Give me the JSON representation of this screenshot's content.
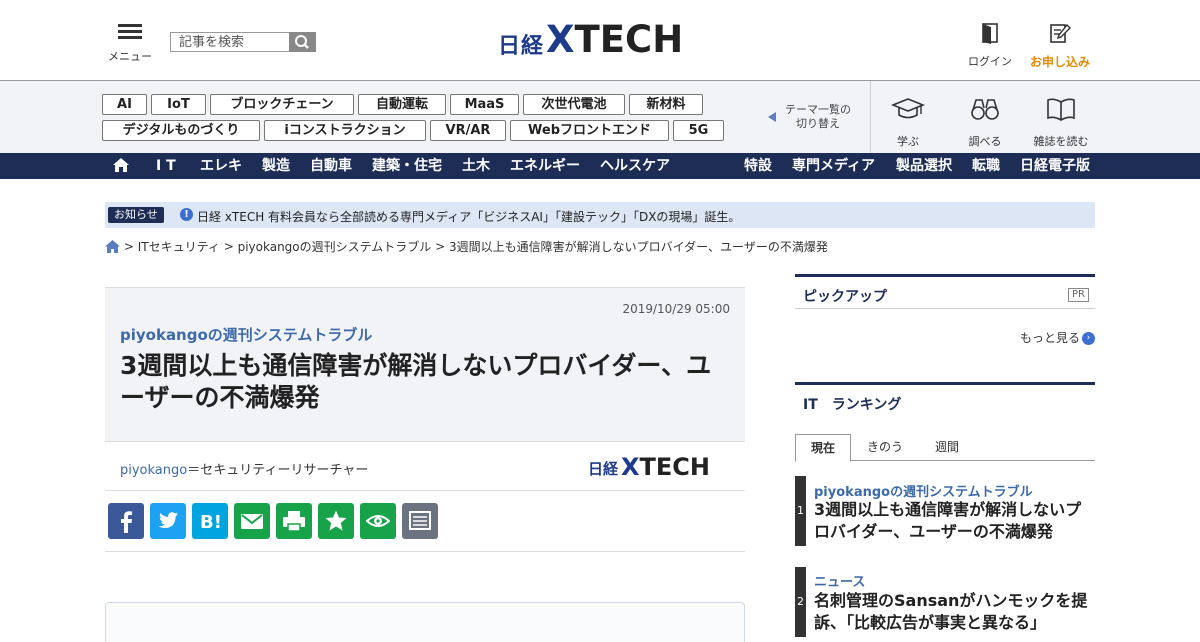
{
  "header": {
    "menu_label": "メニュー",
    "search_placeholder": "記事を検索",
    "logo_nikkei": "日経",
    "logo_x": "X",
    "logo_tech": "TECH",
    "login_label": "ログイン",
    "apply_label": "お申し込み",
    "accent_color": "#e38a00",
    "brand_color": "#1d2d56"
  },
  "themes": {
    "tags": [
      "AI",
      "IoT",
      "ブロックチェーン",
      "自動運転",
      "MaaS",
      "次世代電池",
      "新材料",
      "デジタルものづくり",
      "iコンストラクション",
      "VR/AR",
      "Webフロントエンド",
      "5G"
    ],
    "switch_label_1": "テーマ一覧の",
    "switch_label_2": "切り替え",
    "quick_actions": [
      "学ぶ",
      "調べる",
      "雑誌を読む"
    ]
  },
  "nav": {
    "left": [
      "I T",
      "エレキ",
      "製造",
      "自動車",
      "建築・住宅",
      "土木",
      "エネルギー",
      "ヘルスケア"
    ],
    "right": [
      "特設",
      "専門メディア",
      "製品選択",
      "転職",
      "日経電子版"
    ]
  },
  "notice": {
    "badge": "お知らせ",
    "text": "日経 xTECH 有料会員なら全部読める専門メディア「ビジネスAI」「建設テック」「DXの現場」誕生。"
  },
  "breadcrumb": {
    "items": [
      "ITセキュリティ",
      "piyokangoの週刊システムトラブル",
      "3週間以上も通信障害が解消しないプロバイダー、ユーザーの不満爆発"
    ]
  },
  "article": {
    "date": "2019/10/29 05:00",
    "series": "piyokangoの週刊システムトラブル",
    "title": "3週間以上も通信障害が解消しないプロバイダー、ユーザーの不満爆発",
    "author_name": "piyokango",
    "author_role": "＝セキュリティーリサーチャー"
  },
  "share": {
    "buttons": [
      {
        "name": "facebook",
        "color": "#3b5998"
      },
      {
        "name": "twitter",
        "color": "#1da1f2"
      },
      {
        "name": "hatena-bookmark",
        "color": "#00a4de"
      },
      {
        "name": "mail",
        "color": "#16a34a"
      },
      {
        "name": "print",
        "color": "#16a34a"
      },
      {
        "name": "favorite",
        "color": "#16a34a"
      },
      {
        "name": "watch",
        "color": "#16a34a"
      },
      {
        "name": "memo",
        "color": "#6b7280"
      }
    ]
  },
  "sidebar": {
    "pickup_title": "ピックアップ",
    "pr_label": "PR",
    "more_label": "もっと見る",
    "ranking_title": "IT　ランキング",
    "tabs": [
      "現在",
      "きのう",
      "週間"
    ],
    "ranking": [
      {
        "rank": "1",
        "series": "piyokangoの週刊システムトラブル",
        "title": "3週間以上も通信障害が解消しないプロバイダー、ユーザーの不満爆発"
      },
      {
        "rank": "2",
        "series": "ニュース",
        "title": "名刺管理のSansanがハンモックを提訴、「比較広告が事実と異なる」"
      }
    ]
  }
}
